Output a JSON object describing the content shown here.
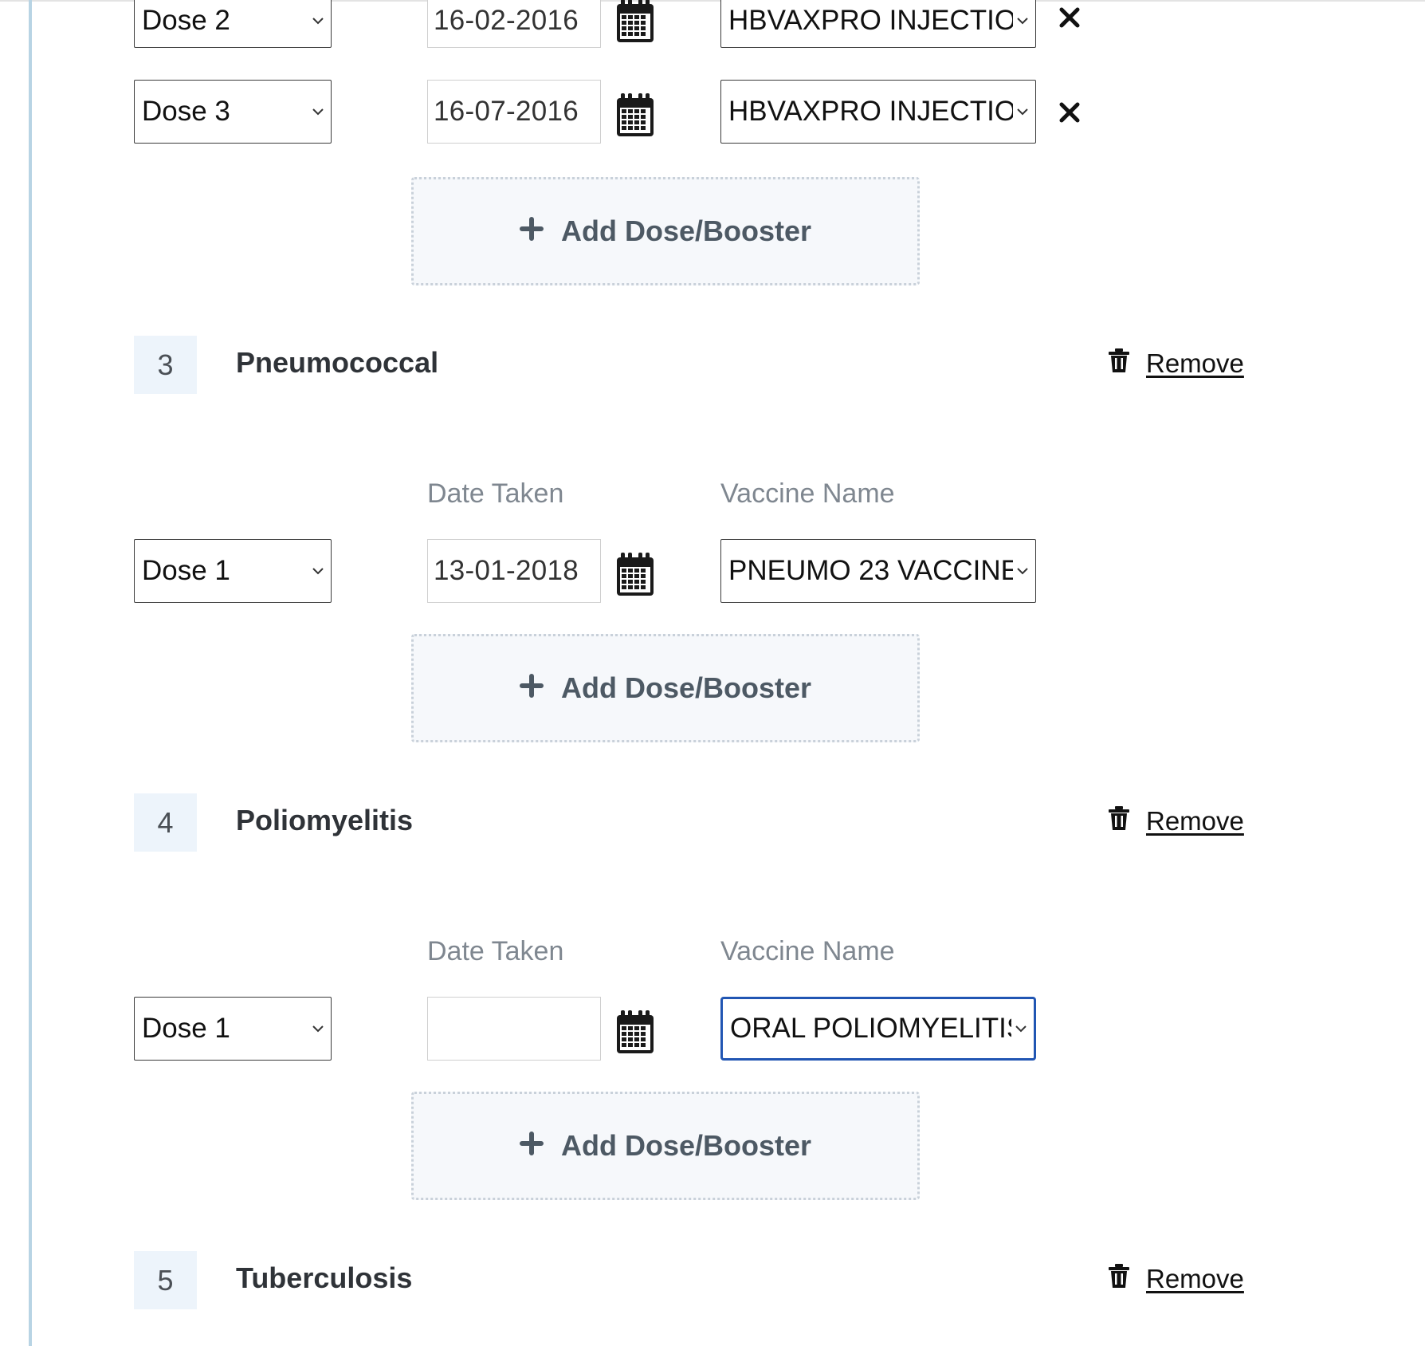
{
  "icons": {
    "calendar": "calendar-icon",
    "remove_dose": "close-icon",
    "add": "plus-icon",
    "trash": "trash-icon",
    "dropdown": "chevron-down-icon"
  },
  "colors": {
    "focus_border": "#2156b3",
    "add_box_bg": "#f6f8fb",
    "badge_bg": "#edf4fb",
    "label_grey": "#7f8790",
    "left_rule": "#b8d4e4"
  },
  "hepatitis_b": {
    "doses": [
      {
        "dose": "Dose 2",
        "date": "16-02-2016",
        "vaccine": "HBVAXPRO INJECTIO"
      },
      {
        "dose": "Dose 3",
        "date": "16-07-2016",
        "vaccine": "HBVAXPRO INJECTIO"
      }
    ],
    "add_label": "Add Dose/Booster"
  },
  "pneumococcal": {
    "number": "3",
    "title": "Pneumococcal",
    "remove_label": "Remove",
    "date_label": "Date Taken",
    "vaccine_label": "Vaccine Name",
    "doses": [
      {
        "dose": "Dose 1",
        "date": "13-01-2018",
        "vaccine": "PNEUMO 23 VACCINE"
      }
    ],
    "add_label": "Add Dose/Booster"
  },
  "poliomyelitis": {
    "number": "4",
    "title": "Poliomyelitis",
    "remove_label": "Remove",
    "date_label": "Date Taken",
    "vaccine_label": "Vaccine Name",
    "doses": [
      {
        "dose": "Dose 1",
        "date": "",
        "vaccine": "ORAL POLIOMYELITIS"
      }
    ],
    "add_label": "Add Dose/Booster"
  },
  "tuberculosis": {
    "number": "5",
    "title": "Tuberculosis",
    "remove_label": "Remove"
  }
}
